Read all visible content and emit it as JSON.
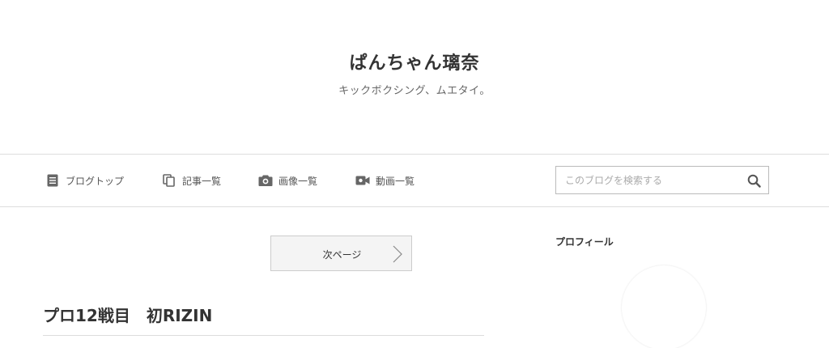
{
  "site": {
    "title": "ぱんちゃん璃奈",
    "description": "キックボクシング、ムエタイ。"
  },
  "nav": {
    "items": [
      {
        "label": "ブログトップ",
        "icon": "document-icon"
      },
      {
        "label": "記事一覧",
        "icon": "copy-icon"
      },
      {
        "label": "画像一覧",
        "icon": "camera-icon"
      },
      {
        "label": "動画一覧",
        "icon": "video-icon"
      }
    ],
    "search": {
      "placeholder": "このブログを検索する",
      "value": "",
      "icon": "search-icon"
    }
  },
  "main": {
    "pager": {
      "next_label": "次ページ",
      "icon": "chevron-right-icon"
    },
    "entry": {
      "title": "プロ12戦目　初RIZIN"
    }
  },
  "sidebar": {
    "profile_heading": "プロフィール"
  },
  "colors": {
    "text": "#333333",
    "muted": "#666666",
    "border": "#dddddd",
    "icon": "#666666"
  }
}
